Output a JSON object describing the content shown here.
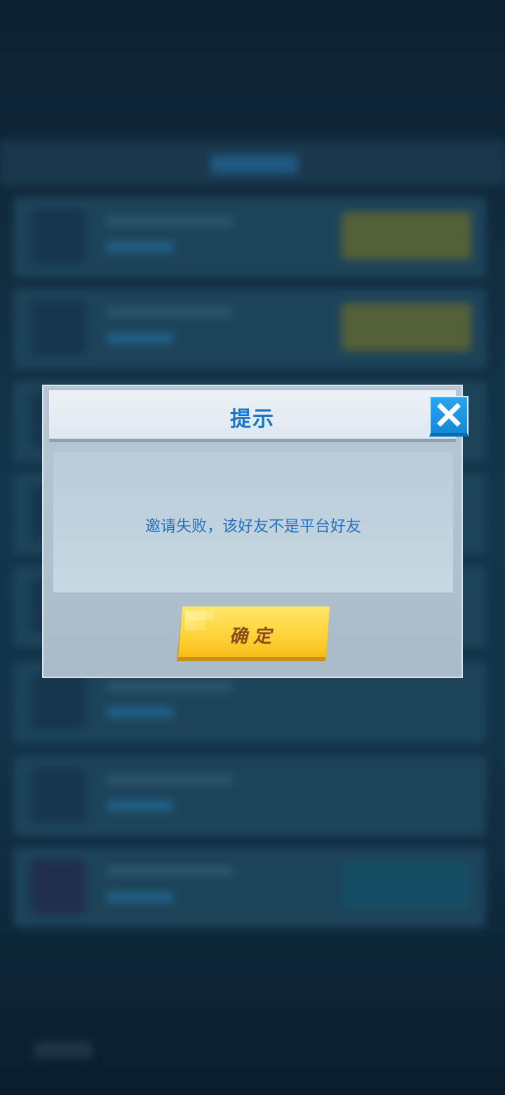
{
  "dialog": {
    "title": "提示",
    "message": "邀请失败，该好友不是平台好友",
    "confirm_label": "确定",
    "close_icon": "close-icon"
  },
  "colors": {
    "title": "#1976c8",
    "message": "#2372c0",
    "close_button": "#1a96e6",
    "confirm_button": "#ffd84a",
    "confirm_text": "#8a4a1a"
  }
}
